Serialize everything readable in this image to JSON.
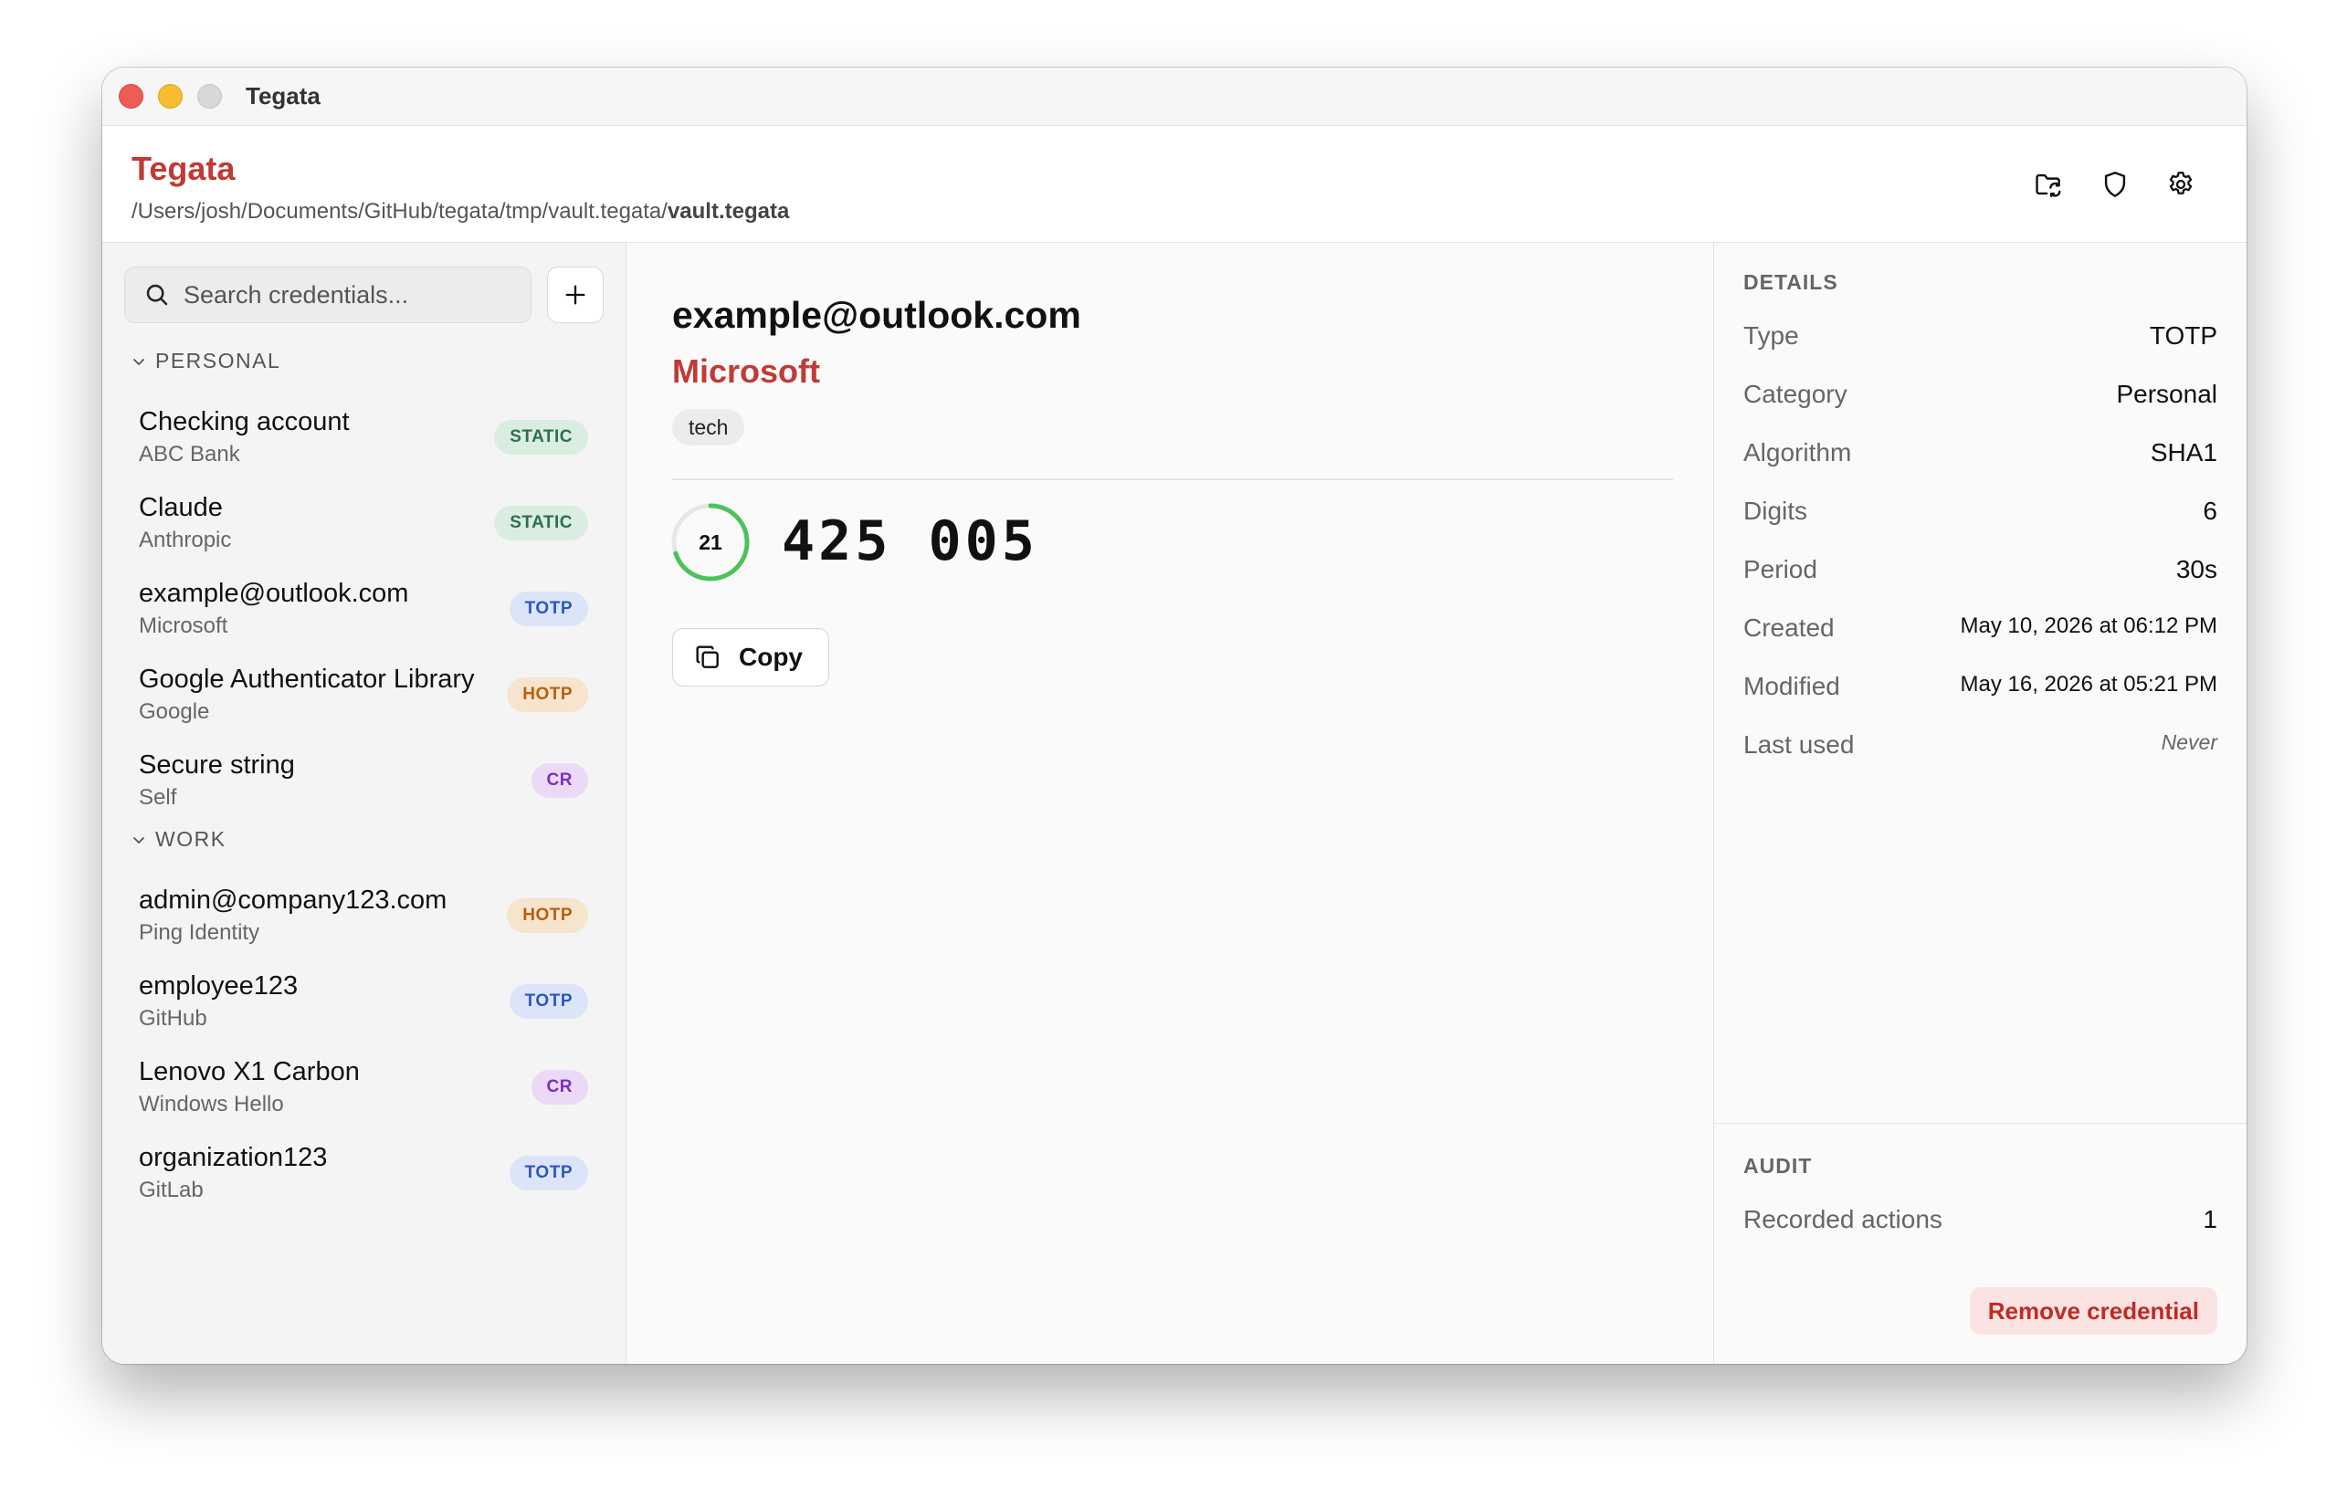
{
  "window": {
    "title": "Tegata"
  },
  "header": {
    "app_name": "Tegata",
    "path_prefix": "/Users/josh/Documents/GitHub/tegata/tmp/vault.tegata/",
    "path_file": "vault.tegata",
    "actions": [
      {
        "icon": "folder-sync-icon"
      },
      {
        "icon": "shield-icon"
      },
      {
        "icon": "gear-icon"
      }
    ]
  },
  "sidebar": {
    "search_placeholder": "Search credentials...",
    "add_icon": "plus-icon",
    "groups": [
      {
        "label": "PERSONAL",
        "items": [
          {
            "name": "Checking account",
            "issuer": "ABC Bank",
            "badge": "STATIC"
          },
          {
            "name": "Claude",
            "issuer": "Anthropic",
            "badge": "STATIC"
          },
          {
            "name": "example@outlook.com",
            "issuer": "Microsoft",
            "badge": "TOTP"
          },
          {
            "name": "Google Authenticator Library",
            "issuer": "Google",
            "badge": "HOTP"
          },
          {
            "name": "Secure string",
            "issuer": "Self",
            "badge": "CR"
          }
        ]
      },
      {
        "label": "WORK",
        "items": [
          {
            "name": "admin@company123.com",
            "issuer": "Ping Identity",
            "badge": "HOTP"
          },
          {
            "name": "employee123",
            "issuer": "GitHub",
            "badge": "TOTP"
          },
          {
            "name": "Lenovo X1 Carbon",
            "issuer": "Windows Hello",
            "badge": "CR"
          },
          {
            "name": "organization123",
            "issuer": "GitLab",
            "badge": "TOTP"
          }
        ]
      }
    ]
  },
  "main": {
    "title": "example@outlook.com",
    "issuer": "Microsoft",
    "tag": "tech",
    "countdown": "21",
    "countdown_fraction": 0.7,
    "code": "425 005",
    "copy_label": "Copy"
  },
  "details": {
    "section_title": "DETAILS",
    "rows": [
      {
        "label": "Type",
        "value": "TOTP"
      },
      {
        "label": "Category",
        "value": "Personal"
      },
      {
        "label": "Algorithm",
        "value": "SHA1"
      },
      {
        "label": "Digits",
        "value": "6"
      },
      {
        "label": "Period",
        "value": "30s"
      },
      {
        "label": "Created",
        "value": "May 10, 2026 at 06:12 PM"
      },
      {
        "label": "Modified",
        "value": "May 16, 2026 at 05:21 PM"
      },
      {
        "label": "Last used",
        "value": "Never"
      }
    ],
    "audit_title": "AUDIT",
    "audit_label": "Recorded actions",
    "audit_value": "1",
    "remove_label": "Remove credential"
  },
  "colors": {
    "accent": "#c13a35",
    "ring": "#4cc25a",
    "static": "#2e7048",
    "totp": "#2d56c4",
    "hotp": "#b8600e",
    "cr": "#7c2fc0"
  }
}
